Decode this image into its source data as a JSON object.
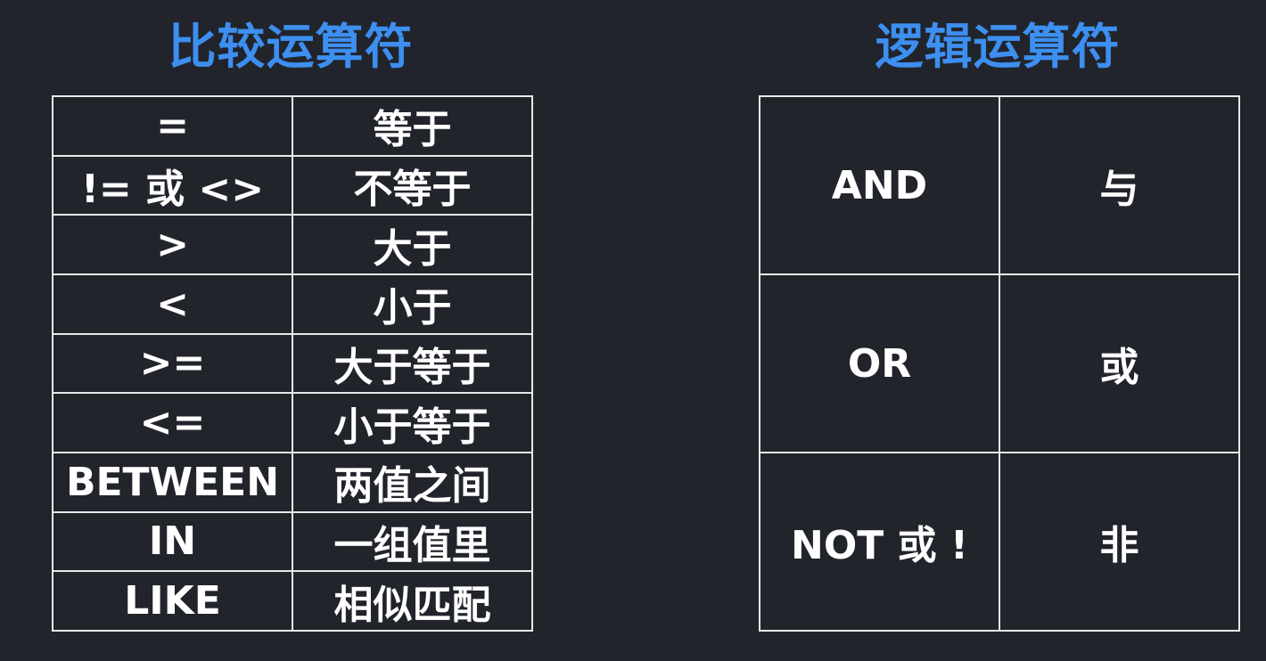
{
  "comparison": {
    "title": "比较运算符",
    "rows": [
      {
        "op": "=",
        "desc": "等于"
      },
      {
        "op": "!= 或 <>",
        "desc": "不等于"
      },
      {
        "op": ">",
        "desc": "大于"
      },
      {
        "op": "<",
        "desc": "小于"
      },
      {
        "op": ">=",
        "desc": "大于等于"
      },
      {
        "op": "<=",
        "desc": "小于等于"
      },
      {
        "op": "BETWEEN",
        "desc": "两值之间"
      },
      {
        "op": "IN",
        "desc": "一组值里"
      },
      {
        "op": "LIKE",
        "desc": "相似匹配"
      }
    ]
  },
  "logical": {
    "title": "逻辑运算符",
    "rows": [
      {
        "op": "AND",
        "desc": "与"
      },
      {
        "op": "OR",
        "desc": "或"
      },
      {
        "op": "NOT 或 !",
        "desc": "非"
      }
    ]
  },
  "colors": {
    "background": "#22242c",
    "title": "#3d8ff0",
    "text": "#ffffff",
    "border": "#e8e8e8"
  }
}
